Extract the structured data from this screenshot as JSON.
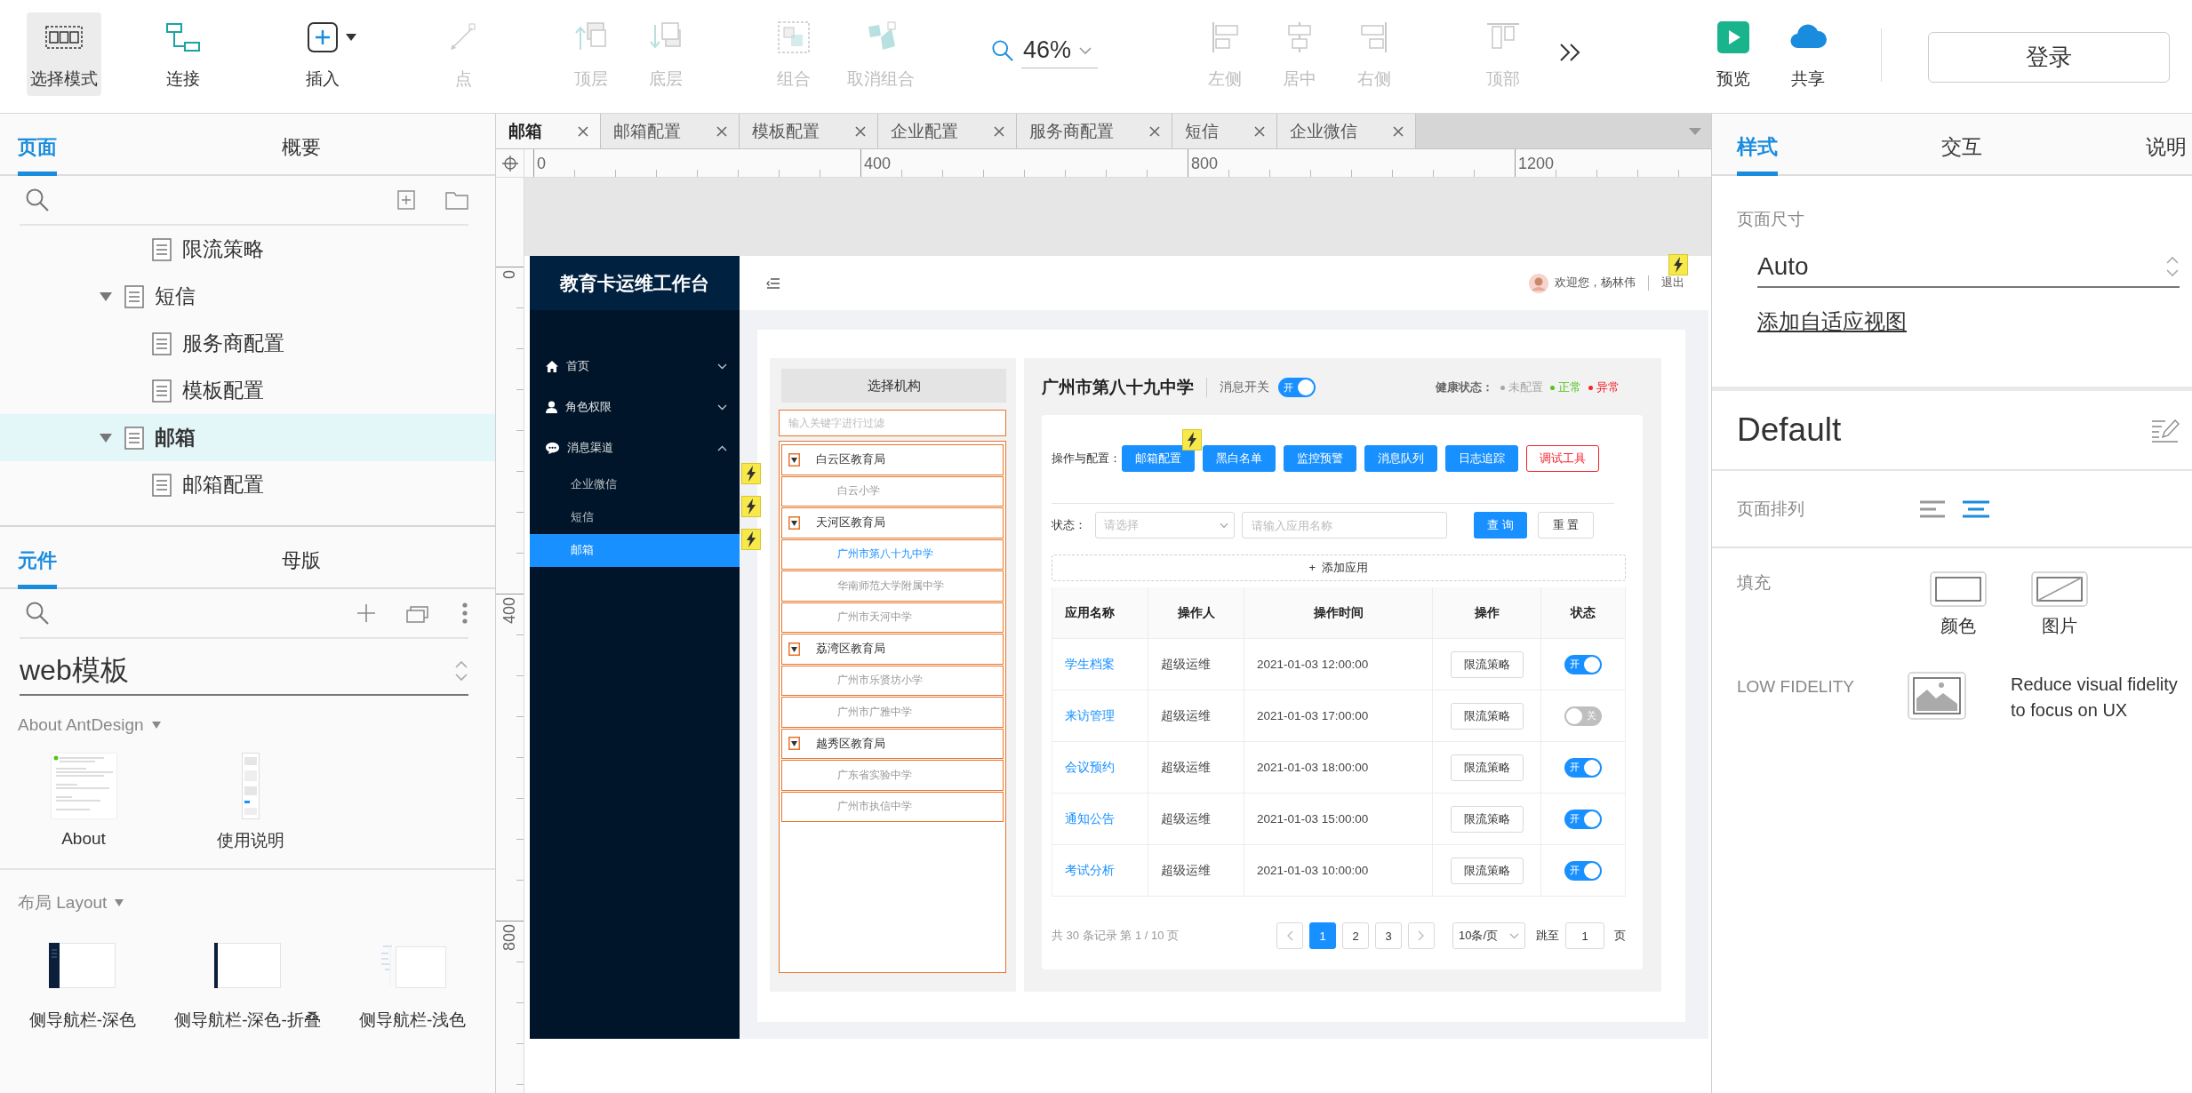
{
  "toolbar": {
    "tools": [
      {
        "label": "选择模式",
        "selected": true,
        "disabled": false
      },
      {
        "label": "连接",
        "selected": false,
        "disabled": false
      },
      {
        "label": "插入",
        "selected": false,
        "disabled": false
      },
      {
        "label": "点",
        "selected": false,
        "disabled": true
      },
      {
        "label": "顶层",
        "selected": false,
        "disabled": true
      },
      {
        "label": "底层",
        "selected": false,
        "disabled": true
      },
      {
        "label": "组合",
        "selected": false,
        "disabled": true
      },
      {
        "label": "取消组合",
        "selected": false,
        "disabled": true
      },
      {
        "label": "左侧",
        "selected": false,
        "disabled": true
      },
      {
        "label": "居中",
        "selected": false,
        "disabled": true
      },
      {
        "label": "右侧",
        "selected": false,
        "disabled": true
      },
      {
        "label": "顶部",
        "selected": false,
        "disabled": true
      },
      {
        "label": "预览",
        "selected": false,
        "disabled": false
      },
      {
        "label": "共享",
        "selected": false,
        "disabled": false
      }
    ],
    "zoom": "46%",
    "login_button": "登录"
  },
  "left_panel": {
    "tabs": [
      {
        "label": "页面",
        "selected": true
      },
      {
        "label": "概要",
        "selected": false
      }
    ],
    "page_tree": [
      {
        "children": [
          {
            "children": [
              {
                "name": "限流策略",
                "selected": false
              }
            ]
          },
          {
            "name": "短信",
            "expanded": true,
            "selected": false,
            "children": [
              {
                "name": "服务商配置",
                "selected": false
              },
              {
                "name": "模板配置",
                "selected": false
              }
            ]
          },
          {
            "name": "邮箱",
            "expanded": true,
            "selected": true,
            "children": [
              {
                "name": "邮箱配置",
                "selected": false
              }
            ]
          }
        ]
      }
    ],
    "library_tabs": [
      {
        "label": "元件",
        "selected": true
      },
      {
        "label": "母版",
        "selected": false
      }
    ],
    "library": "web模板",
    "sections": [
      {
        "title": "About AntDesign",
        "expanded": true,
        "items": [
          {
            "label": "About",
            "kind": "doc"
          },
          {
            "label": "使用说明",
            "kind": "strip"
          }
        ]
      },
      {
        "title": "布局 Layout",
        "expanded": true,
        "items": [
          {
            "label": "侧导航栏-深色",
            "kind": "dark"
          },
          {
            "label": "侧导航栏-深色-折叠",
            "kind": "dark-folded"
          },
          {
            "label": "侧导航栏-浅色",
            "kind": "light"
          }
        ]
      }
    ]
  },
  "editor": {
    "tabs": [
      {
        "label": "邮箱",
        "selected": true
      },
      {
        "label": "邮箱配置",
        "selected": false
      },
      {
        "label": "模板配置",
        "selected": false
      },
      {
        "label": "企业配置",
        "selected": false
      },
      {
        "label": "服务商配置",
        "selected": false
      },
      {
        "label": "短信",
        "selected": false
      },
      {
        "label": "企业微信",
        "selected": false
      }
    ],
    "ruler": {
      "x_labels": [
        "0",
        "400",
        "800",
        "1200"
      ],
      "y_labels": [
        "0",
        "400",
        "800"
      ]
    },
    "page": {
      "app_title": "教育卡运维工作台",
      "menu": [
        {
          "label": "首页",
          "expanded": false
        },
        {
          "label": "角色权限",
          "expanded": false
        },
        {
          "label": "消息渠道",
          "expanded": true,
          "children": [
            {
              "label": "企业微信",
              "selected": false,
              "interaction": true
            },
            {
              "label": "短信",
              "selected": false,
              "interaction": true
            },
            {
              "label": "邮箱",
              "selected": true,
              "interaction": true
            }
          ]
        }
      ],
      "user": {
        "greeting": "欢迎您，杨林伟",
        "logout": "退出",
        "logout_interaction": true
      },
      "org_panel": {
        "title": "选择机构",
        "filter_placeholder": "输入关键字进行过滤",
        "orgs": [
          {
            "name": "白云区教育局",
            "expanded": true,
            "children": [
              {
                "name": "白云小学",
                "selected": false
              }
            ]
          },
          {
            "name": "天河区教育局",
            "expanded": true,
            "children": [
              {
                "name": "广州市第八十九中学",
                "selected": true
              },
              {
                "name": "华南师范大学附属中学",
                "selected": false
              },
              {
                "name": "广州市天河中学",
                "selected": false
              }
            ]
          },
          {
            "name": "荔湾区教育局",
            "expanded": true,
            "children": [
              {
                "name": "广州市乐贤坊小学",
                "selected": false
              },
              {
                "name": "广州市广雅中学",
                "selected": false
              }
            ]
          },
          {
            "name": "越秀区教育局",
            "expanded": true,
            "children": [
              {
                "name": "广东省实验中学",
                "selected": false
              },
              {
                "name": "广州市执信中学",
                "selected": false
              }
            ]
          }
        ]
      },
      "school": {
        "name": "广州市第八十九中学",
        "switch_label": "消息开关",
        "switch": {
          "on": true,
          "text": "开"
        },
        "health_label": "健康状态：",
        "health": [
          {
            "label": "未配置",
            "color": "#a6a6a6"
          },
          {
            "label": "正常",
            "color": "#52c41a"
          },
          {
            "label": "异常",
            "color": "#f5222d"
          }
        ]
      },
      "actions_label": "操作与配置：",
      "actions": [
        {
          "label": "邮箱配置",
          "kind": "primary",
          "interaction": true
        },
        {
          "label": "黑白名单",
          "kind": "primary",
          "interaction": false
        },
        {
          "label": "监控预警",
          "kind": "primary",
          "interaction": false
        },
        {
          "label": "消息队列",
          "kind": "primary",
          "interaction": false
        },
        {
          "label": "日志追踪",
          "kind": "primary",
          "interaction": false
        },
        {
          "label": "调试工具",
          "kind": "danger",
          "interaction": false
        }
      ],
      "filter": {
        "label": "状态：",
        "status_placeholder": "请选择",
        "name_placeholder": "请输入应用名称",
        "search": "查 询",
        "reset": "重 置"
      },
      "add_button": "+  添加应用",
      "table": {
        "columns": [
          "应用名称",
          "操作人",
          "操作时间",
          "操作",
          "状态"
        ],
        "rows": [
          {
            "name": "学生档案",
            "operator": "超级运维",
            "time": "2021-01-03 12:00:00",
            "action": "限流策略",
            "status": {
              "on": true,
              "text": "开"
            }
          },
          {
            "name": "来访管理",
            "operator": "超级运维",
            "time": "2021-01-03 17:00:00",
            "action": "限流策略",
            "status": {
              "on": false,
              "text": "关"
            }
          },
          {
            "name": "会议预约",
            "operator": "超级运维",
            "time": "2021-01-03 18:00:00",
            "action": "限流策略",
            "status": {
              "on": true,
              "text": "开"
            }
          },
          {
            "name": "通知公告",
            "operator": "超级运维",
            "time": "2021-01-03 15:00:00",
            "action": "限流策略",
            "status": {
              "on": true,
              "text": "开"
            }
          },
          {
            "name": "考试分析",
            "operator": "超级运维",
            "time": "2021-01-03 10:00:00",
            "action": "限流策略",
            "status": {
              "on": true,
              "text": "开"
            }
          }
        ]
      },
      "pagination": {
        "summary": "共 30 条记录 第 1 / 10 页",
        "pages": [
          {
            "label": "1",
            "selected": true
          },
          {
            "label": "2",
            "selected": false
          },
          {
            "label": "3",
            "selected": false
          }
        ],
        "page_size": "10条/页",
        "jump_label": "跳至",
        "jump_value": "1",
        "page_suffix": "页"
      }
    }
  },
  "right_panel": {
    "tabs": [
      {
        "label": "样式",
        "selected": true
      },
      {
        "label": "交互",
        "selected": false
      },
      {
        "label": "说明",
        "selected": false
      }
    ],
    "page_size_label": "页面尺寸",
    "page_size": "Auto",
    "adaptive_link": "添加自适应视图",
    "style_name": "Default",
    "align_label": "页面排列",
    "align_options": [
      {
        "kind": "left",
        "selected": false
      },
      {
        "kind": "center",
        "selected": true
      }
    ],
    "fill_label": "填充",
    "fill_options": [
      {
        "label": "颜色",
        "kind": "color"
      },
      {
        "label": "图片",
        "kind": "image"
      }
    ],
    "low_fidelity_label": "LOW FIDELITY",
    "low_fidelity_text": "Reduce visual fidelity to focus on UX"
  }
}
